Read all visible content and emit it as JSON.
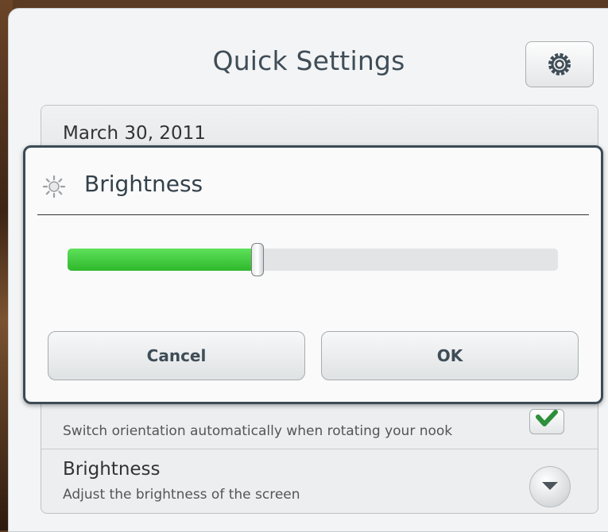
{
  "panel": {
    "title": "Quick Settings",
    "date": "March 30, 2011"
  },
  "orientation": {
    "subtitle": "Switch orientation automatically when rotating your nook",
    "checked": true
  },
  "brightness_row": {
    "title": "Brightness",
    "subtitle": "Adjust the brightness of the screen"
  },
  "dialog": {
    "title": "Brightness",
    "brightness_level": 0.385,
    "cancel_label": "Cancel",
    "ok_label": "OK"
  },
  "colors": {
    "slider_fill": "#3cc538",
    "check": "#2e8f3a",
    "dialog_border": "#3b4b56"
  },
  "icons": {
    "settings": "gear-icon",
    "dialog": "brightness-icon",
    "orientation": "checkmark-icon",
    "dropdown": "chevron-down-icon"
  }
}
